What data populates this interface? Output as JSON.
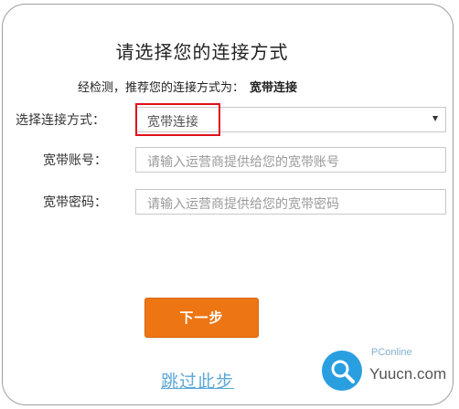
{
  "dialog": {
    "title": "请选择您的连接方式",
    "detect_prefix": "经检测，推荐您的连接方式为：",
    "detect_result": "宽带连接"
  },
  "form": {
    "connection_label": "选择连接方式：",
    "connection_value": "宽带连接",
    "account_label": "宽带账号：",
    "account_placeholder": "请输入运营商提供给您的宽带账号",
    "password_label": "宽带密码：",
    "password_placeholder": "请输入运营商提供给您的宽带密码"
  },
  "actions": {
    "next_label": "下一步",
    "skip_label": "跳过此步"
  },
  "watermark": {
    "small_text": "PConline",
    "big_text": "Yuucn.com"
  },
  "colors": {
    "primary_button": "#ee7513",
    "link": "#5ba8d8",
    "highlight_border": "#e0101a",
    "watermark_logo": "#2a9fe0"
  },
  "icons": {
    "select_caret": "caret-down-icon",
    "watermark_logo": "magnifier-logo-icon"
  }
}
